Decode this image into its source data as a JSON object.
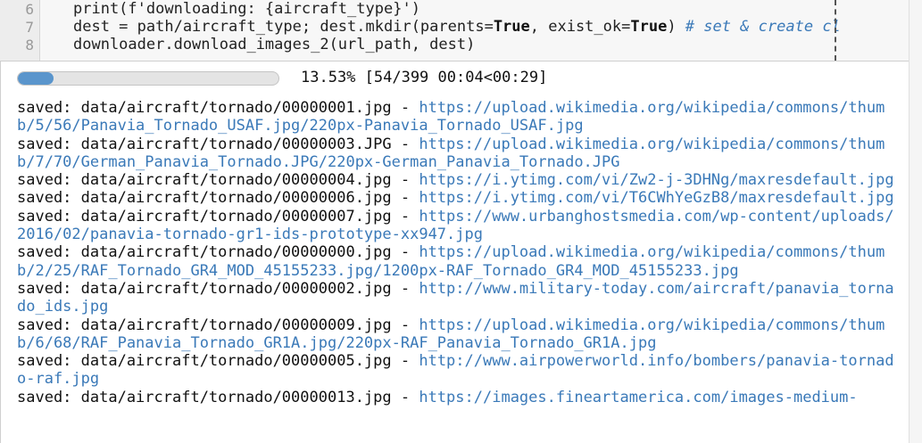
{
  "code": {
    "lines": [
      {
        "num": "6",
        "pre": "print(f'downloading: {aircraft_type}')",
        "kw1": "",
        "mid": "",
        "kw2": "",
        "post": "",
        "comment": ""
      },
      {
        "num": "7",
        "pre": "dest = path/aircraft_type; dest.mkdir(parents=",
        "kw1": "True",
        "mid": ", exist_ok=",
        "kw2": "True",
        "post": ") ",
        "comment": "# set & create cl"
      },
      {
        "num": "8",
        "pre": "downloader.download_images_2(url_path, dest)",
        "kw1": "",
        "mid": "",
        "kw2": "",
        "post": "",
        "comment": ""
      }
    ]
  },
  "progress": {
    "fraction": 0.1353,
    "text": "13.53% [54/399 00:04<00:29]"
  },
  "log": [
    {
      "prefix": "saved: data/aircraft/tornado/00000001.jpg - ",
      "url": "https://upload.wikimedia.org/wikipedia/commons/thumb/5/56/Panavia_Tornado_USAF.jpg/220px-Panavia_Tornado_USAF.jpg"
    },
    {
      "prefix": "saved: data/aircraft/tornado/00000003.JPG - ",
      "url": "https://upload.wikimedia.org/wikipedia/commons/thumb/7/70/German_Panavia_Tornado.JPG/220px-German_Panavia_Tornado.JPG"
    },
    {
      "prefix": "saved: data/aircraft/tornado/00000004.jpg - ",
      "url": "https://i.ytimg.com/vi/Zw2-j-3DHNg/maxresdefault.jpg"
    },
    {
      "prefix": "saved: data/aircraft/tornado/00000006.jpg - ",
      "url": "https://i.ytimg.com/vi/T6CWhYeGzB8/maxresdefault.jpg"
    },
    {
      "prefix": "saved: data/aircraft/tornado/00000007.jpg - ",
      "url": "https://www.urbanghostsmedia.com/wp-content/uploads/2016/02/panavia-tornado-gr1-ids-prototype-xx947.jpg"
    },
    {
      "prefix": "saved: data/aircraft/tornado/00000000.jpg - ",
      "url": "https://upload.wikimedia.org/wikipedia/commons/thumb/2/25/RAF_Tornado_GR4_MOD_45155233.jpg/1200px-RAF_Tornado_GR4_MOD_45155233.jpg"
    },
    {
      "prefix": "saved: data/aircraft/tornado/00000002.jpg - ",
      "url": "http://www.military-today.com/aircraft/panavia_tornado_ids.jpg"
    },
    {
      "prefix": "saved: data/aircraft/tornado/00000009.jpg - ",
      "url": "https://upload.wikimedia.org/wikipedia/commons/thumb/6/68/RAF_Panavia_Tornado_GR1A.jpg/220px-RAF_Panavia_Tornado_GR1A.jpg"
    },
    {
      "prefix": "saved: data/aircraft/tornado/00000005.jpg - ",
      "url": "http://www.airpowerworld.info/bombers/panavia-tornado-raf.jpg"
    },
    {
      "prefix": "saved: data/aircraft/tornado/00000013.jpg - ",
      "url": "https://images.fineartamerica.com/images-medium-"
    }
  ],
  "colors": {
    "url": "#3a79b8",
    "progress_fill": "#5a95cc",
    "progress_track": "#e4e4e4"
  }
}
